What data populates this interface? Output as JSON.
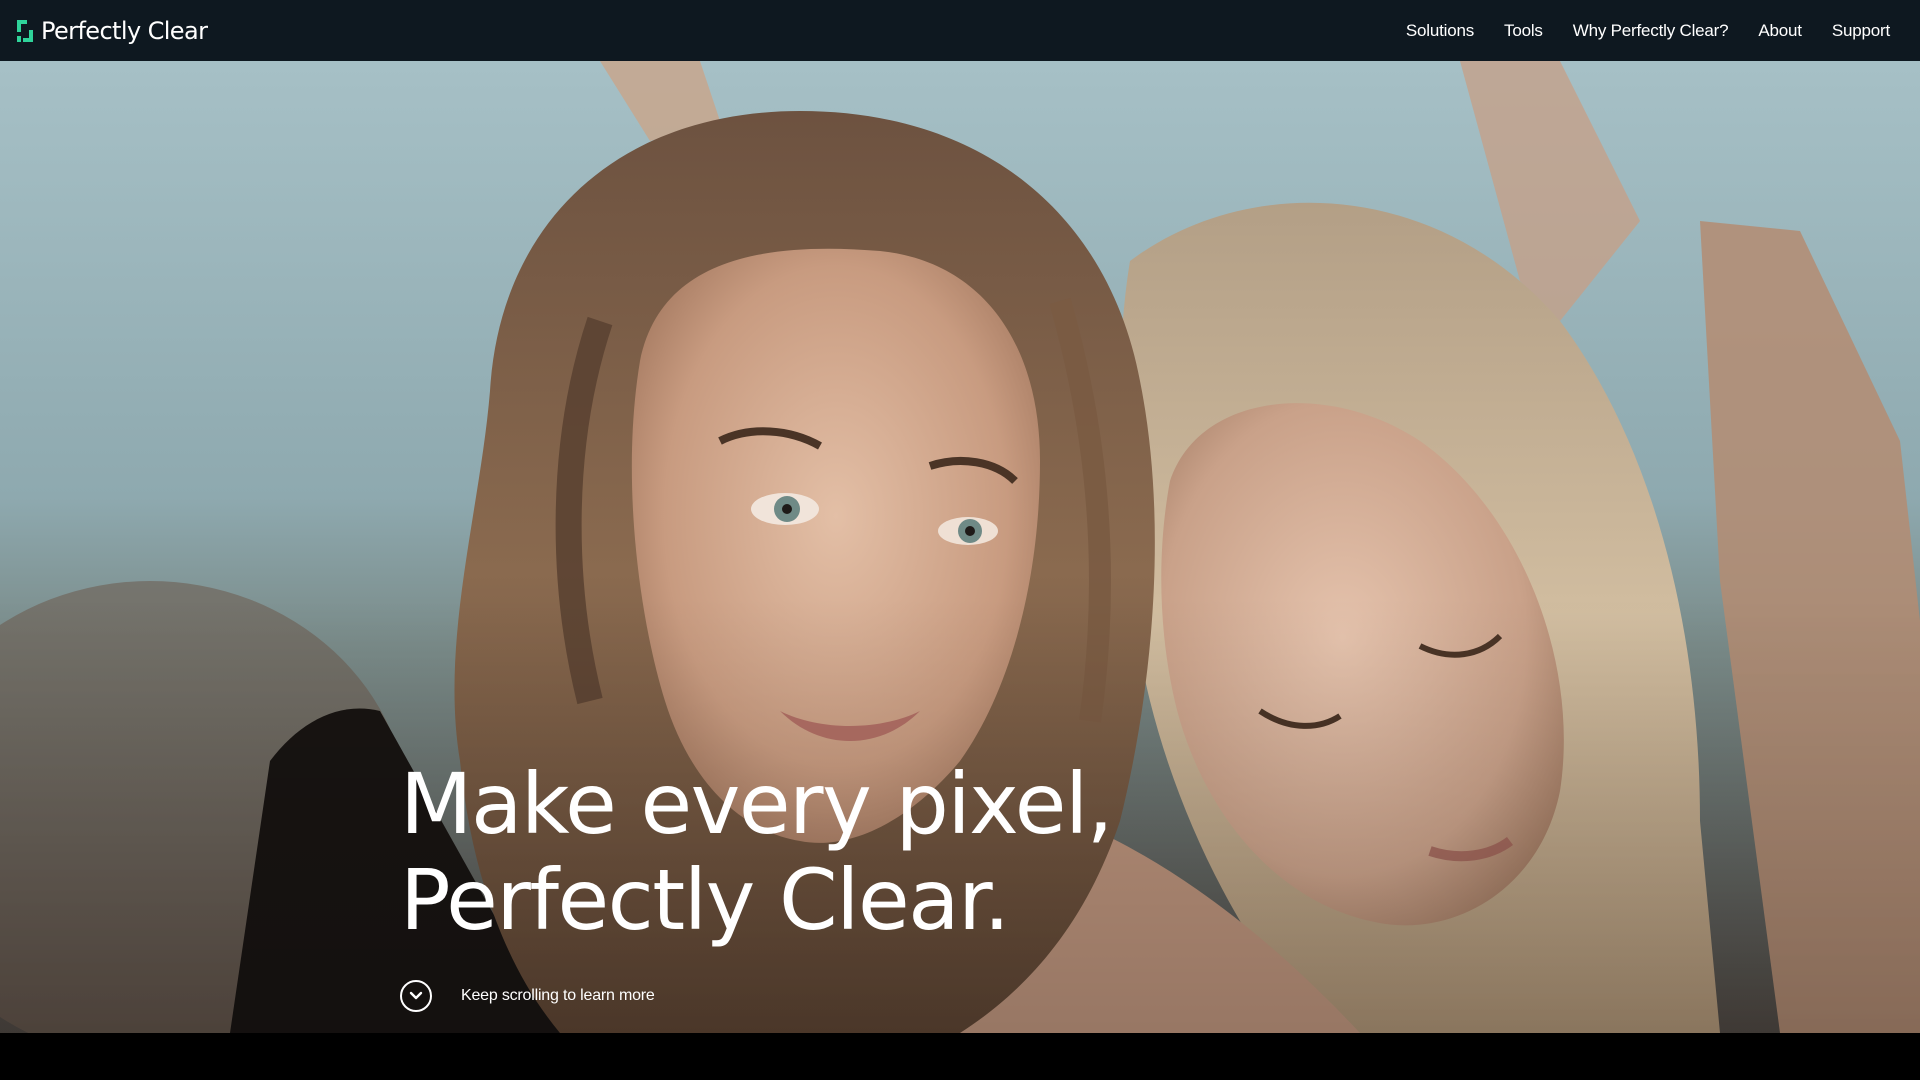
{
  "header": {
    "logo_text": "Perfectly Clear",
    "nav": [
      {
        "label": "Solutions"
      },
      {
        "label": "Tools"
      },
      {
        "label": "Why Perfectly Clear?"
      },
      {
        "label": "About"
      },
      {
        "label": "Support"
      }
    ]
  },
  "hero": {
    "headline_line1": "Make every pixel,",
    "headline_line2": "Perfectly Clear.",
    "scroll_text": "Keep scrolling to learn more",
    "image": "two-women-lying-on-beach-photo",
    "icon": "chevron-down-icon"
  },
  "colors": {
    "navbar_bg": "#0e1820",
    "brand_accent": "#2fd39a",
    "text": "#ffffff"
  }
}
